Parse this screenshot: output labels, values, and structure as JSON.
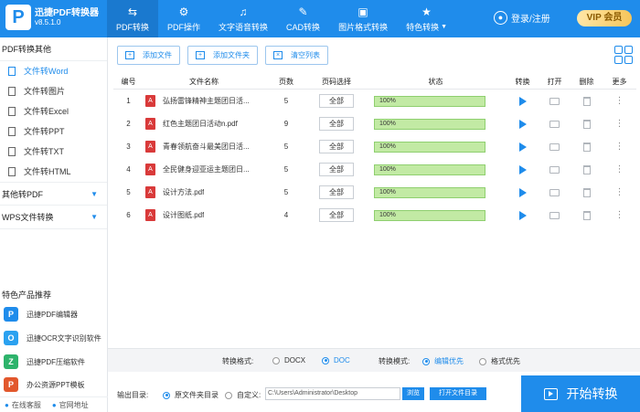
{
  "app": {
    "logo_letter": "P",
    "title": "迅捷PDF转换器",
    "version": "v8.5.1.0"
  },
  "nav": {
    "tabs": [
      {
        "label": "PDF转换",
        "icon": "⇆"
      },
      {
        "label": "PDF操作",
        "icon": "⚙"
      },
      {
        "label": "文字语音转换",
        "icon": "♫"
      },
      {
        "label": "CAD转换",
        "icon": "✎"
      },
      {
        "label": "图片格式转换",
        "icon": "▣"
      },
      {
        "label": "特色转换",
        "icon": "★"
      }
    ],
    "login": "登录/注册",
    "vip": "VIP 会员"
  },
  "sidebar": {
    "section1": "PDF转换其他",
    "items": [
      "文件转Word",
      "文件转图片",
      "文件转Excel",
      "文件转PPT",
      "文件转TXT",
      "文件转HTML"
    ],
    "section2": "其他转PDF",
    "section3": "WPS文件转换",
    "products_title": "特色产品推荐",
    "products": [
      {
        "name": "迅捷PDF编辑器",
        "color": "#1f8ceb",
        "glyph": "P"
      },
      {
        "name": "迅捷OCR文字识别软件",
        "color": "#2aa1f0",
        "glyph": "O"
      },
      {
        "name": "迅捷PDF压缩软件",
        "color": "#2db36b",
        "glyph": "Z"
      },
      {
        "name": "办公资源PPT模板",
        "color": "#e2572c",
        "glyph": "P"
      }
    ],
    "footer_service": "在线客服",
    "footer_site": "官网地址"
  },
  "toolbar": {
    "add_file": "添加文件",
    "add_folder": "添加文件夹",
    "clear_list": "清空列表"
  },
  "table": {
    "headers": [
      "编号",
      "文件名称",
      "页数",
      "页码选择",
      "状态",
      "转换",
      "打开",
      "删除",
      "更多"
    ],
    "rows": [
      {
        "num": "1",
        "name": "弘扬雷锋精神主题团日活...",
        "pages": "5",
        "range": "全部",
        "progress": 100,
        "status": "100%"
      },
      {
        "num": "2",
        "name": "红色主题团日活动n.pdf",
        "pages": "9",
        "range": "全部",
        "progress": 100,
        "status": "100%"
      },
      {
        "num": "3",
        "name": "青春领航奋斗最美团日活...",
        "pages": "5",
        "range": "全部",
        "progress": 100,
        "status": "100%"
      },
      {
        "num": "4",
        "name": "全民健身迎亚运主题团日...",
        "pages": "5",
        "range": "全部",
        "progress": 100,
        "status": "100%"
      },
      {
        "num": "5",
        "name": "设计方法.pdf",
        "pages": "5",
        "range": "全部",
        "progress": 100,
        "status": "100%"
      },
      {
        "num": "6",
        "name": "设计图纸.pdf",
        "pages": "4",
        "range": "全部",
        "progress": 100,
        "status": "100%"
      }
    ]
  },
  "format": {
    "label": "转换格式:",
    "docx": "DOCX",
    "doc": "DOC",
    "mode_label": "转换模式:",
    "edit_first": "编辑优先",
    "format_first": "格式优先"
  },
  "output": {
    "label": "输出目录:",
    "source_folder": "原文件夹目录",
    "custom": "自定义:",
    "path": "C:\\Users\\Administrator\\Desktop",
    "browse": "浏览",
    "open_folder": "打开文件目录"
  },
  "start": "开始转换"
}
